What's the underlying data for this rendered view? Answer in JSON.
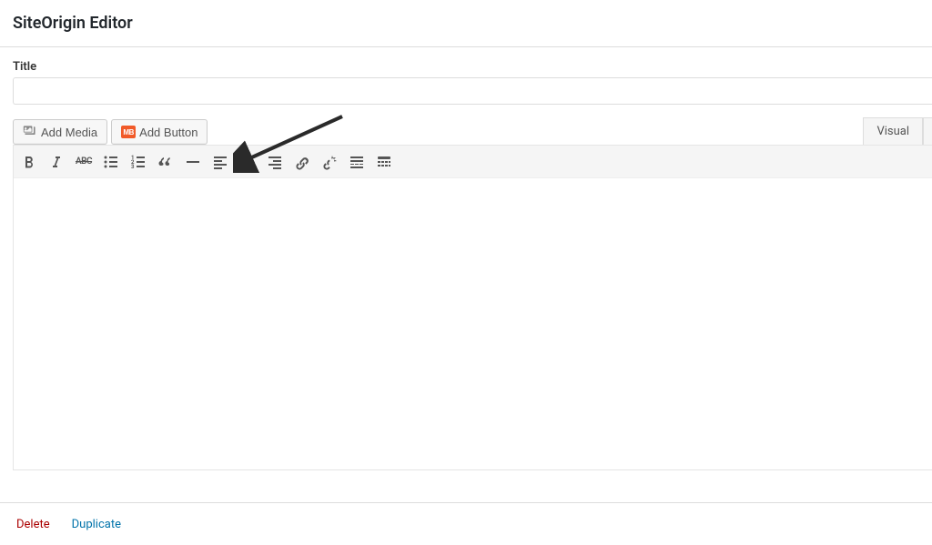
{
  "header": {
    "title": "SiteOrigin Editor"
  },
  "fields": {
    "title_label": "Title",
    "title_value": ""
  },
  "buttons": {
    "add_media": "Add Media",
    "add_button": "Add Button"
  },
  "tabs": {
    "visual": "Visual"
  },
  "toolbar": {
    "items": [
      {
        "name": "bold-icon"
      },
      {
        "name": "italic-icon"
      },
      {
        "name": "strikethrough-icon"
      },
      {
        "name": "bullet-list-icon"
      },
      {
        "name": "numbered-list-icon"
      },
      {
        "name": "blockquote-icon"
      },
      {
        "name": "hr-icon"
      },
      {
        "name": "align-left-icon"
      },
      {
        "name": "align-center-icon"
      },
      {
        "name": "align-right-icon"
      },
      {
        "name": "link-icon"
      },
      {
        "name": "unlink-icon"
      },
      {
        "name": "read-more-icon"
      },
      {
        "name": "toolbar-toggle-icon"
      }
    ]
  },
  "footer": {
    "delete": "Delete",
    "duplicate": "Duplicate"
  },
  "icons": {
    "mb_label": "MB"
  }
}
